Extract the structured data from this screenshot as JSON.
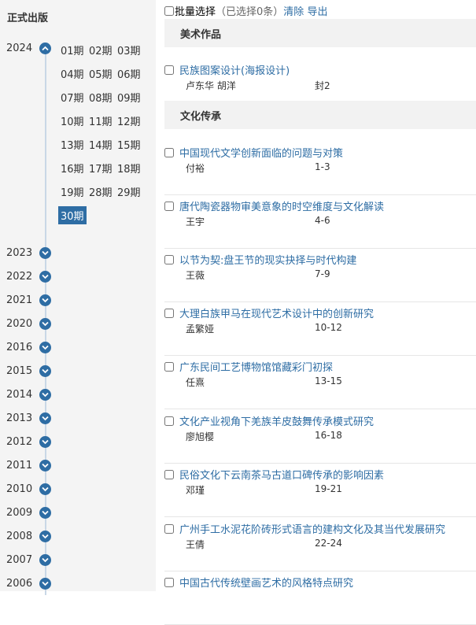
{
  "sidebar": {
    "title": "正式出版",
    "current_year": "2024",
    "issues": [
      "01期",
      "02期",
      "03期",
      "04期",
      "05期",
      "06期",
      "07期",
      "08期",
      "09期",
      "10期",
      "11期",
      "12期",
      "13期",
      "14期",
      "15期",
      "16期",
      "17期",
      "18期",
      "19期",
      "28期",
      "29期",
      "30期"
    ],
    "active_issue": "30期",
    "years": [
      "2023",
      "2022",
      "2021",
      "2020",
      "2016",
      "2015",
      "2014",
      "2013",
      "2012",
      "2011",
      "2010",
      "2009",
      "2008",
      "2007",
      "2006"
    ]
  },
  "toolbar": {
    "batch_label": "批量选择",
    "selected_text": "（已选择0条）",
    "clear_label": "清除",
    "export_label": "导出"
  },
  "sections": [
    {
      "name": "美术作品",
      "articles": [
        {
          "title": "民族图案设计(海报设计)",
          "author": "卢东华 胡洋",
          "pages": "封2"
        }
      ]
    },
    {
      "name": "文化传承",
      "articles": [
        {
          "title": "中国现代文学创新面临的问题与对策",
          "author": "付裕",
          "pages": "1-3"
        },
        {
          "title": "唐代陶瓷器物审美意象的时空维度与文化解读",
          "author": "王宇",
          "pages": "4-6"
        },
        {
          "title": "以节为契:盘王节的现实抉择与时代构建",
          "author": "王薇",
          "pages": "7-9"
        },
        {
          "title": "大理白族甲马在现代艺术设计中的创新研究",
          "author": "孟繁娅",
          "pages": "10-12"
        },
        {
          "title": "广东民间工艺博物馆馆藏彩门初探",
          "author": "任熹",
          "pages": "13-15"
        },
        {
          "title": "文化产业视角下羌族羊皮鼓舞传承模式研究",
          "author": "廖旭樱",
          "pages": "16-18"
        },
        {
          "title": "民俗文化下云南茶马古道口碑传承的影响因素",
          "author": "邓瑾",
          "pages": "19-21"
        },
        {
          "title": "广州手工水泥花阶砖形式语言的建构文化及其当代发展研究",
          "author": "王倩",
          "pages": "22-24"
        },
        {
          "title": "中国古代传统壁画艺术的风格特点研究",
          "author": "",
          "pages": ""
        }
      ]
    }
  ]
}
